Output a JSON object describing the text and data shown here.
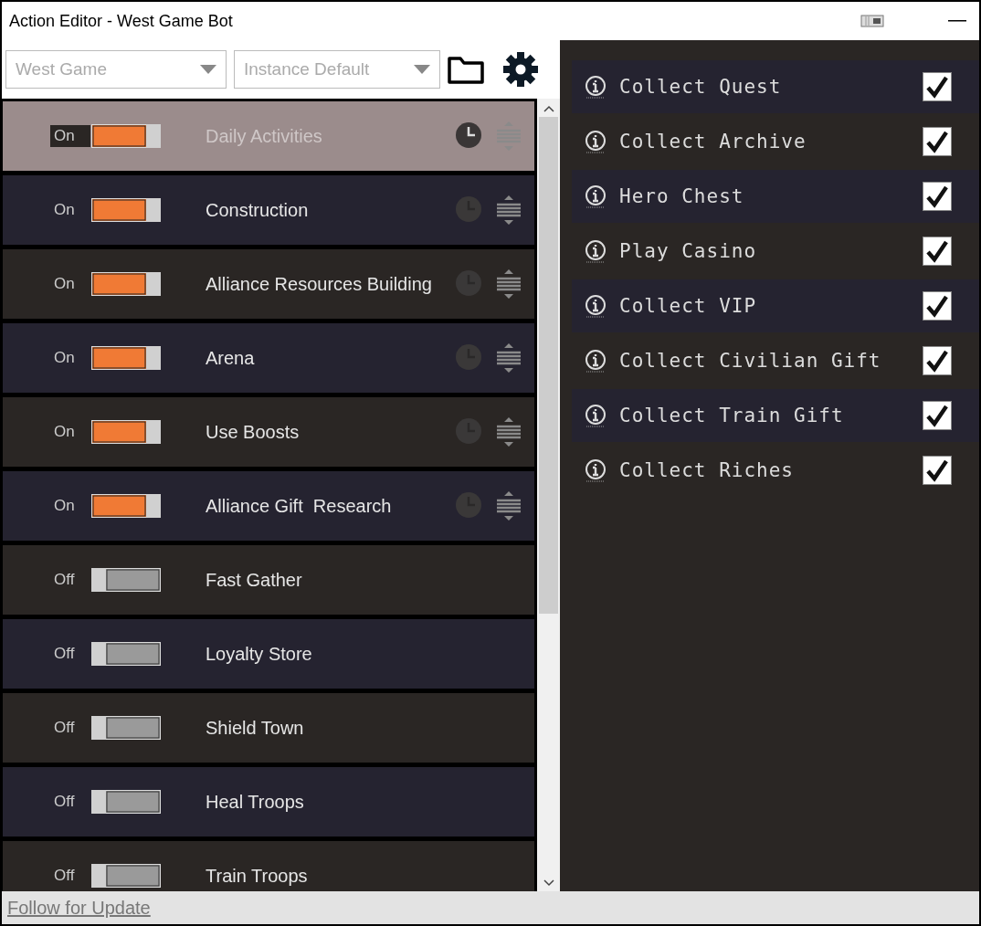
{
  "window": {
    "title": "Action Editor - West Game Bot"
  },
  "toolbar": {
    "game": "West Game",
    "instance": "Instance Default"
  },
  "actions": [
    {
      "label": "Daily Activities",
      "state": "On",
      "enabled": true,
      "selected": true
    },
    {
      "label": "Construction",
      "state": "On",
      "enabled": true,
      "selected": false
    },
    {
      "label": "Alliance Resources Building",
      "state": "On",
      "enabled": true,
      "selected": false
    },
    {
      "label": "Arena",
      "state": "On",
      "enabled": true,
      "selected": false
    },
    {
      "label": "Use Boosts",
      "state": "On",
      "enabled": true,
      "selected": false
    },
    {
      "label": "Alliance Gift  Research",
      "state": "On",
      "enabled": true,
      "selected": false
    },
    {
      "label": "Fast Gather",
      "state": "Off",
      "enabled": false,
      "selected": false
    },
    {
      "label": "Loyalty Store",
      "state": "Off",
      "enabled": false,
      "selected": false
    },
    {
      "label": "Shield Town",
      "state": "Off",
      "enabled": false,
      "selected": false
    },
    {
      "label": "Heal Troops",
      "state": "Off",
      "enabled": false,
      "selected": false
    },
    {
      "label": "Train Troops",
      "state": "Off",
      "enabled": false,
      "selected": false
    }
  ],
  "tasks": [
    {
      "label": "Collect Quest",
      "checked": true
    },
    {
      "label": "Collect Archive",
      "checked": true
    },
    {
      "label": "Hero Chest",
      "checked": true
    },
    {
      "label": "Play Casino",
      "checked": true
    },
    {
      "label": "Collect VIP",
      "checked": true
    },
    {
      "label": "Collect Civilian Gift",
      "checked": true
    },
    {
      "label": "Collect Train Gift",
      "checked": true
    },
    {
      "label": "Collect Riches",
      "checked": true
    }
  ],
  "footer": {
    "link": "Follow for Update"
  }
}
